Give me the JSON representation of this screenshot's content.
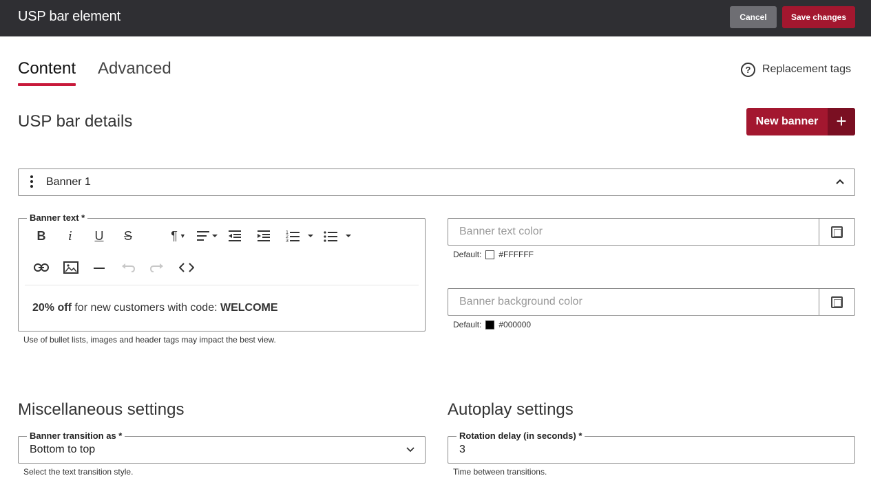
{
  "header": {
    "title": "USP bar element",
    "cancel_label": "Cancel",
    "save_label": "Save changes"
  },
  "tabs": [
    {
      "label": "Content",
      "active": true
    },
    {
      "label": "Advanced",
      "active": false
    }
  ],
  "replacement_tags": {
    "label": "Replacement tags",
    "icon": "help-circle-icon"
  },
  "usp_section": {
    "title": "USP bar details",
    "new_banner_label": "New banner",
    "new_banner_icon": "+"
  },
  "banner": {
    "label": "Banner 1",
    "expanded": true,
    "text_field": {
      "label": "Banner text *",
      "content_bold_1": "20% off",
      "content_plain": " for new customers with code: ",
      "content_bold_2": "WELCOME",
      "hint": "Use of bullet lists, images and header tags may impact the best view."
    },
    "toolbar": {
      "row1": [
        "bold-icon",
        "italic-icon",
        "underline-icon",
        "strikethrough-icon",
        "paragraph-format-icon",
        "align-icon",
        "outdent-icon",
        "indent-icon",
        "ordered-list-icon",
        "bullet-list-icon"
      ],
      "row2": [
        "link-icon",
        "image-icon",
        "horizontal-rule-icon",
        "undo-icon",
        "redo-icon",
        "code-view-icon"
      ]
    },
    "text_color": {
      "placeholder": "Banner text color",
      "default_label": "Default:",
      "default_value": "#FFFFFF",
      "swatch": "#FFFFFF"
    },
    "background_color": {
      "placeholder": "Banner background color",
      "default_label": "Default:",
      "default_value": "#000000",
      "swatch": "#000000"
    }
  },
  "misc": {
    "title": "Miscellaneous settings",
    "transition_label": "Banner transition as *",
    "transition_value": "Bottom to top",
    "transition_hint": "Select the text transition style."
  },
  "autoplay": {
    "title": "Autoplay settings",
    "delay_label": "Rotation delay (in seconds) *",
    "delay_value": "3",
    "delay_hint": "Time between transitions."
  },
  "colors": {
    "topbar": "#2f2f33",
    "accent": "#a3172f",
    "tab_underline": "#c8193a",
    "cancel": "#6e6e73"
  }
}
